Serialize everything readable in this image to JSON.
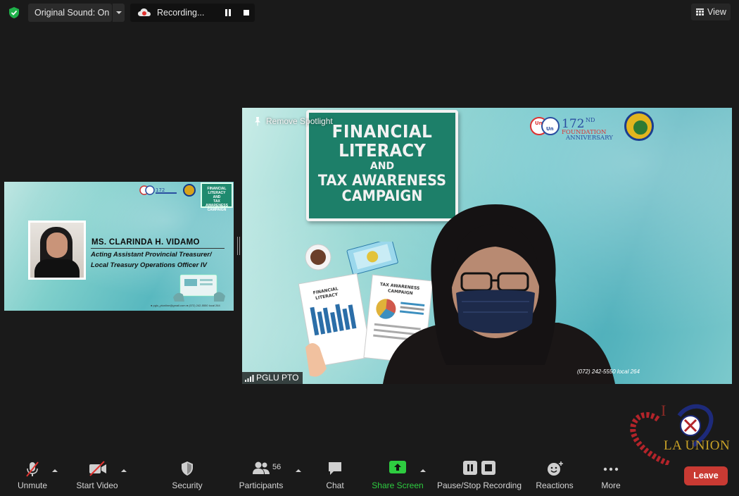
{
  "topbar": {
    "original_sound": "Original Sound: On",
    "recording_label": "Recording...",
    "view_label": "View"
  },
  "thumbnail": {
    "speaker_name": "MS. CLARINDA H. VIDAMO",
    "role_line1": "Acting Assistant Provincial Treasurer/",
    "role_line2": "Local Treasury Operations Officer IV"
  },
  "main_video": {
    "spotlight_label": "Remove Spotlight",
    "sign_line1": "FINANCIAL",
    "sign_line2": "LITERACY",
    "sign_line3": "AND",
    "sign_line4": "TAX AWARENESS",
    "sign_line5": "CAMPAIGN",
    "logo_number": "172",
    "logo_suffix": "ND",
    "logo_text1": "FOUNDATION",
    "logo_text2": "ANNIVERSARY",
    "paper1_title": "FINANCIAL LITERACY",
    "paper2_title": "TAX AWARENESS CAMPAIGN",
    "phone_text": "(072) 242-5550 local 264",
    "participant_name": "PGLU PTO"
  },
  "watermark": {
    "line1": "I",
    "line2": "LA UNION"
  },
  "toolbar": {
    "unmute": "Unmute",
    "start_video": "Start Video",
    "security": "Security",
    "participants": "Participants",
    "participants_count": "56",
    "chat": "Chat",
    "share_screen": "Share Screen",
    "pause_stop_recording": "Pause/Stop Recording",
    "reactions": "Reactions",
    "more": "More",
    "leave": "Leave"
  },
  "colors": {
    "background": "#1a1a1a",
    "share_green": "#2ecc40",
    "leave_red": "#c93a33",
    "mute_red": "#e0322f"
  }
}
